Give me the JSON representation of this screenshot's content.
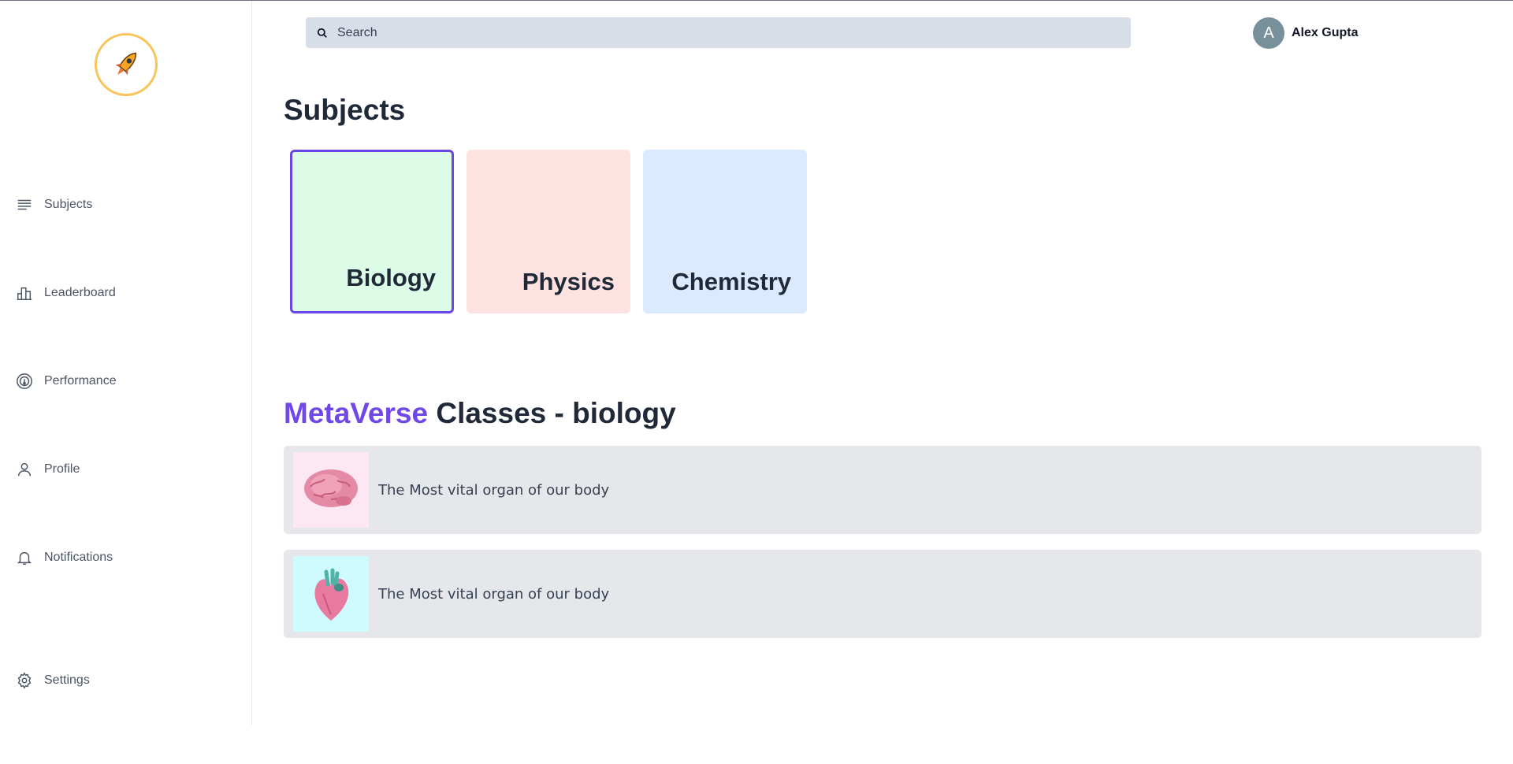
{
  "search": {
    "placeholder": "Search"
  },
  "user": {
    "initial": "A",
    "name": "Alex Gupta"
  },
  "sidebar": {
    "items": [
      {
        "label": "Subjects",
        "icon": "list-icon"
      },
      {
        "label": "Leaderboard",
        "icon": "bar-chart-icon"
      },
      {
        "label": "Performance",
        "icon": "gauge-icon"
      },
      {
        "label": "Profile",
        "icon": "user-icon"
      },
      {
        "label": "Notifications",
        "icon": "bell-icon"
      },
      {
        "label": "Settings",
        "icon": "gear-icon"
      }
    ]
  },
  "main": {
    "title": "Subjects",
    "subjects": [
      {
        "label": "Biology",
        "color": "#dcfce7",
        "selected": true
      },
      {
        "label": "Physics",
        "color": "#fee2e2"
      },
      {
        "label": "Chemistry",
        "color": "#dbeafe"
      }
    ],
    "classes_section": {
      "accent": "MetaVerse",
      "title": "Classes - biology",
      "items": [
        {
          "text": "The Most vital organ of our body",
          "thumb": "brain-image",
          "thumb_bg": "#fce7f3"
        },
        {
          "text": "The Most vital organ of our body",
          "thumb": "heart-image",
          "thumb_bg": "#cffafe"
        }
      ]
    }
  },
  "colors": {
    "accent": "#7048e8",
    "logo_ring": "#f7c55a"
  }
}
